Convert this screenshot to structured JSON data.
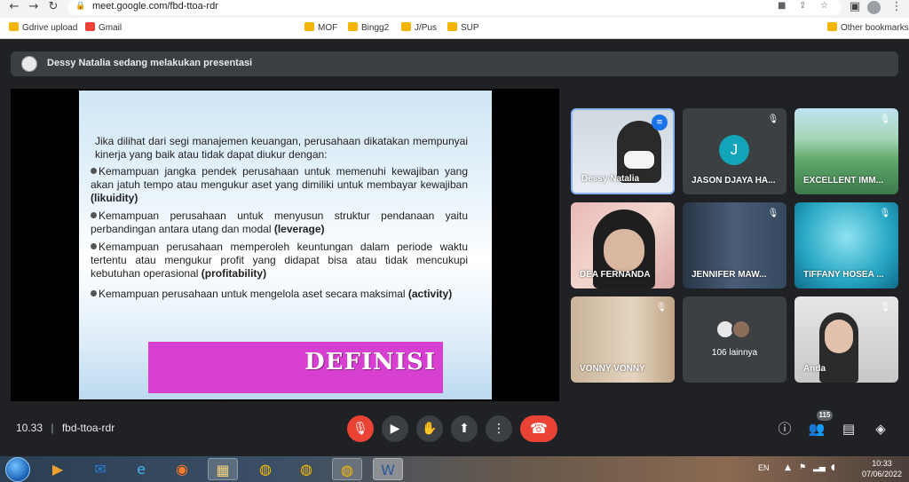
{
  "browser": {
    "url": "meet.google.com/fbd-ttoa-rdr",
    "bookmarks": [
      "Gdrive upload",
      "Gmail",
      "MOF",
      "Bingg2",
      "J/Pus",
      "SUP"
    ],
    "other_bookmarks": "Other bookmarks"
  },
  "meet": {
    "presenting_banner": "Dessy Natalia sedang melakukan presentasi",
    "slide": {
      "intro": "Jika dilihat dari segi manajemen keuangan, perusahaan dikatakan mempunyai kinerja yang baik atau tidak dapat diukur dengan:",
      "bullets": [
        {
          "text": "Kemampuan jangka pendek perusahaan untuk memenuhi kewajiban yang akan jatuh tempo atau mengukur aset yang dimiliki untuk membayar kewajiban ",
          "bold": "(likuidity)"
        },
        {
          "text": "Kemampuan perusahaan untuk menyusun struktur  pendanaan yaitu perbandingan antara utang dan modal ",
          "bold": "(leverage)"
        },
        {
          "text": "Kemampuan perusahaan memperoleh keuntungan dalam periode waktu tertentu atau mengukur profit yang didapat bisa atau tidak mencukupi kebutuhan operasional ",
          "bold": "(profitability)"
        },
        {
          "text": "Kemampuan perusahaan untuk mengelola aset secara maksimal ",
          "bold": "(activity)"
        }
      ],
      "definisi": "DEFINISI"
    },
    "participants": [
      {
        "name": "Dessy Natalia"
      },
      {
        "name": "JASON DJAYA HA...",
        "initial": "J"
      },
      {
        "name": "EXCELLENT IMM..."
      },
      {
        "name": "DEA FERNANDA"
      },
      {
        "name": "JENNIFER MAW..."
      },
      {
        "name": "TIFFANY HOSEA ..."
      },
      {
        "name": "VONNY VONNY"
      },
      {
        "name": "106 lainnya"
      },
      {
        "name": "Anda"
      }
    ],
    "time": "10.33",
    "meeting_code": "fbd-ttoa-rdr",
    "participant_count": "115"
  },
  "taskbar": {
    "lang": "EN",
    "time": "10:33",
    "date": "07/06/2022"
  },
  "colors": {
    "meet_bg": "#202124",
    "tile_bg": "#3c4043",
    "red": "#ea4335",
    "definisi_bg": "#d63fcf",
    "accent_blue": "#8ab4f8"
  }
}
